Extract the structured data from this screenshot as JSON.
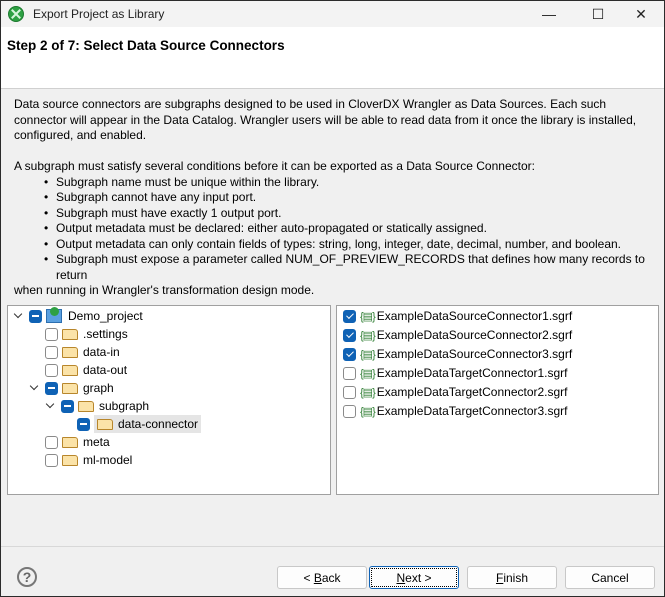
{
  "window": {
    "title": "Export Project as Library",
    "minimize": "—",
    "maximize": "☐",
    "close": "✕"
  },
  "header": {
    "step": "Step 2 of 7: Select Data Source Connectors"
  },
  "description": {
    "intro": "Data source connectors are subgraphs designed to be used in CloverDX Wrangler as Data Sources. Each such connector will appear in the Data Catalog. Wrangler users will be able to read data from it once the library is installed, configured, and enabled.",
    "conditions_intro": "A subgraph must satisfy several conditions before it can be exported as a Data Source Connector:",
    "conditions": [
      "Subgraph name must be unique within the library.",
      "Subgraph cannot have any input port.",
      "Subgraph must have exactly 1 output port.",
      "Output metadata must be declared: either auto-propagated or statically assigned.",
      "Output metadata can only contain fields of types: string, long, integer, date, decimal, number, and boolean.",
      "Subgraph must expose a parameter called NUM_OF_PREVIEW_RECORDS that defines how many records to return"
    ],
    "conditions_tail": "when running in Wrangler's transformation design mode."
  },
  "tree": [
    {
      "label": "Demo_project",
      "state": "mixed",
      "expanded": true
    },
    {
      "label": ".settings",
      "state": "off"
    },
    {
      "label": "data-in",
      "state": "off"
    },
    {
      "label": "data-out",
      "state": "off"
    },
    {
      "label": "graph",
      "state": "mixed",
      "expanded": true
    },
    {
      "label": "subgraph",
      "state": "mixed",
      "expanded": true
    },
    {
      "label": "data-connector",
      "state": "mixed",
      "selected": true
    },
    {
      "label": "meta",
      "state": "off"
    },
    {
      "label": "ml-model",
      "state": "off"
    }
  ],
  "files": [
    {
      "label": "ExampleDataSourceConnector1.sgrf",
      "checked": true
    },
    {
      "label": "ExampleDataSourceConnector2.sgrf",
      "checked": true
    },
    {
      "label": "ExampleDataSourceConnector3.sgrf",
      "checked": true
    },
    {
      "label": "ExampleDataTargetConnector1.sgrf",
      "checked": false
    },
    {
      "label": "ExampleDataTargetConnector2.sgrf",
      "checked": false
    },
    {
      "label": "ExampleDataTargetConnector3.sgrf",
      "checked": false
    }
  ],
  "buttons": {
    "help": "?",
    "back": {
      "pre": "< ",
      "key": "B",
      "rest": "ack"
    },
    "next": {
      "pre": "",
      "key": "N",
      "rest": "ext >"
    },
    "finish": {
      "pre": "",
      "key": "F",
      "rest": "inish"
    },
    "cancel": "Cancel"
  },
  "colors": {
    "accent": "#0f62b5",
    "app_icon": "#2ea043"
  }
}
